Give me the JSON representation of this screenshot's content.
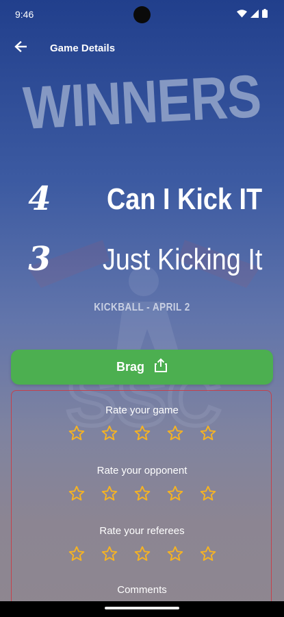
{
  "status_bar": {
    "time": "9:46"
  },
  "app_bar": {
    "title": "Game Details"
  },
  "banner": {
    "text": "WINNERS"
  },
  "teams": [
    {
      "score": "4",
      "name": "Can I Kick IT",
      "winner": true
    },
    {
      "score": "3",
      "name": "Just Kicking It",
      "winner": false
    }
  ],
  "game_info": "KICKBALL - APRIL 2",
  "brag_button": {
    "label": "Brag"
  },
  "ratings": [
    {
      "label": "Rate your game",
      "stars": 5,
      "filled": 0
    },
    {
      "label": "Rate your opponent",
      "stars": 5,
      "filled": 0
    },
    {
      "label": "Rate your referees",
      "stars": 5,
      "filled": 0
    }
  ],
  "comments_label": "Comments",
  "colors": {
    "accent_green": "#4caf50",
    "star_outline": "#f5b324",
    "box_border": "#c6404a"
  },
  "icons": [
    "back-arrow-icon",
    "wifi-icon",
    "signal-icon",
    "battery-icon",
    "share-icon",
    "star-outline-icon"
  ]
}
